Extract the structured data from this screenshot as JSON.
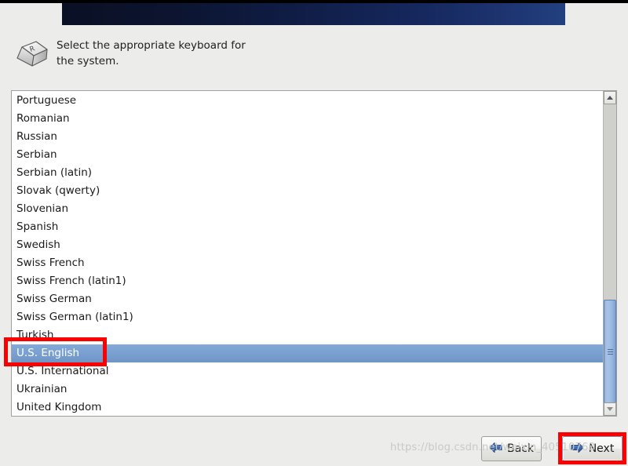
{
  "window": {
    "top_strip_color": "#000000",
    "background_color": "#ececea"
  },
  "header": {
    "title": "",
    "gradient_from": "#0a1024",
    "gradient_to": "#22407f"
  },
  "prompt": {
    "icon": "keyboard-keycap-icon",
    "keycap_letter": "R",
    "text": "Select the appropriate keyboard for\nthe system."
  },
  "keyboard_list": {
    "selected": "U.S. English",
    "selection_color": "#7aa0d1",
    "items": [
      {
        "label": "Portuguese",
        "selected": false
      },
      {
        "label": "Romanian",
        "selected": false
      },
      {
        "label": "Russian",
        "selected": false
      },
      {
        "label": "Serbian",
        "selected": false
      },
      {
        "label": "Serbian (latin)",
        "selected": false
      },
      {
        "label": "Slovak (qwerty)",
        "selected": false
      },
      {
        "label": "Slovenian",
        "selected": false
      },
      {
        "label": "Spanish",
        "selected": false
      },
      {
        "label": "Swedish",
        "selected": false
      },
      {
        "label": "Swiss French",
        "selected": false
      },
      {
        "label": "Swiss French (latin1)",
        "selected": false
      },
      {
        "label": "Swiss German",
        "selected": false
      },
      {
        "label": "Swiss German (latin1)",
        "selected": false
      },
      {
        "label": "Turkish",
        "selected": false
      },
      {
        "label": "U.S. English",
        "selected": true
      },
      {
        "label": "U.S. International",
        "selected": false
      },
      {
        "label": "Ukrainian",
        "selected": false
      },
      {
        "label": "United Kingdom",
        "selected": false
      }
    ]
  },
  "scrollbar": {
    "up_icon": "chevron-up-icon",
    "down_icon": "chevron-down-icon",
    "thumb_icon": "scrollbar-grip-icon",
    "thumb_color": "#9dbbe2"
  },
  "footer": {
    "back_label": "Back",
    "back_icon": "arrow-left-icon",
    "next_label": "Next",
    "next_icon": "arrow-right-icon"
  },
  "annotations": {
    "highlight_color": "#fa0000",
    "boxes": [
      {
        "target": "U.S. English"
      },
      {
        "target": "Next"
      }
    ]
  },
  "watermark": {
    "text": "https://blog.csdn.net/weixin_40510768"
  }
}
